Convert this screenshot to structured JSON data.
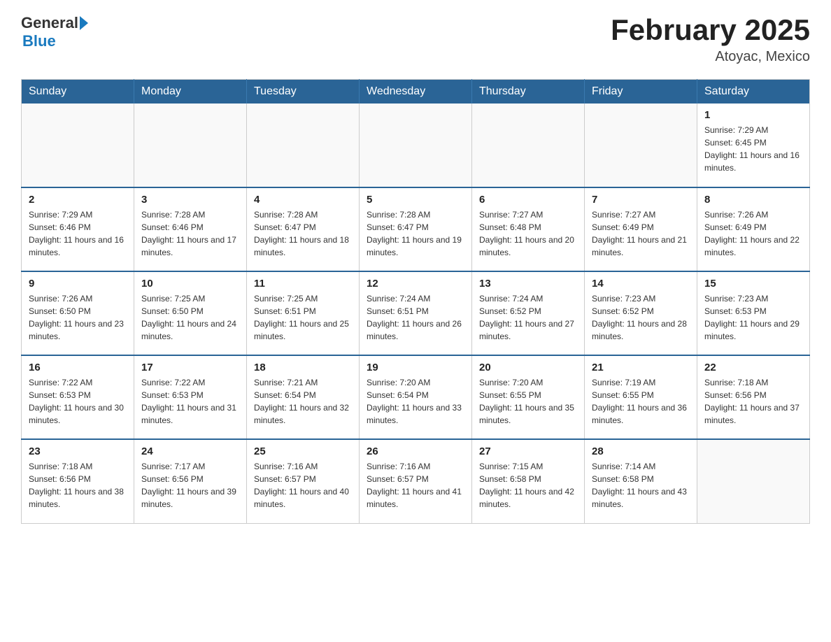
{
  "header": {
    "logo_text_general": "General",
    "logo_text_blue": "Blue",
    "month_title": "February 2025",
    "location": "Atoyac, Mexico"
  },
  "weekdays": [
    "Sunday",
    "Monday",
    "Tuesday",
    "Wednesday",
    "Thursday",
    "Friday",
    "Saturday"
  ],
  "weeks": [
    [
      {
        "day": "",
        "sunrise": "",
        "sunset": "",
        "daylight": ""
      },
      {
        "day": "",
        "sunrise": "",
        "sunset": "",
        "daylight": ""
      },
      {
        "day": "",
        "sunrise": "",
        "sunset": "",
        "daylight": ""
      },
      {
        "day": "",
        "sunrise": "",
        "sunset": "",
        "daylight": ""
      },
      {
        "day": "",
        "sunrise": "",
        "sunset": "",
        "daylight": ""
      },
      {
        "day": "",
        "sunrise": "",
        "sunset": "",
        "daylight": ""
      },
      {
        "day": "1",
        "sunrise": "Sunrise: 7:29 AM",
        "sunset": "Sunset: 6:45 PM",
        "daylight": "Daylight: 11 hours and 16 minutes."
      }
    ],
    [
      {
        "day": "2",
        "sunrise": "Sunrise: 7:29 AM",
        "sunset": "Sunset: 6:46 PM",
        "daylight": "Daylight: 11 hours and 16 minutes."
      },
      {
        "day": "3",
        "sunrise": "Sunrise: 7:28 AM",
        "sunset": "Sunset: 6:46 PM",
        "daylight": "Daylight: 11 hours and 17 minutes."
      },
      {
        "day": "4",
        "sunrise": "Sunrise: 7:28 AM",
        "sunset": "Sunset: 6:47 PM",
        "daylight": "Daylight: 11 hours and 18 minutes."
      },
      {
        "day": "5",
        "sunrise": "Sunrise: 7:28 AM",
        "sunset": "Sunset: 6:47 PM",
        "daylight": "Daylight: 11 hours and 19 minutes."
      },
      {
        "day": "6",
        "sunrise": "Sunrise: 7:27 AM",
        "sunset": "Sunset: 6:48 PM",
        "daylight": "Daylight: 11 hours and 20 minutes."
      },
      {
        "day": "7",
        "sunrise": "Sunrise: 7:27 AM",
        "sunset": "Sunset: 6:49 PM",
        "daylight": "Daylight: 11 hours and 21 minutes."
      },
      {
        "day": "8",
        "sunrise": "Sunrise: 7:26 AM",
        "sunset": "Sunset: 6:49 PM",
        "daylight": "Daylight: 11 hours and 22 minutes."
      }
    ],
    [
      {
        "day": "9",
        "sunrise": "Sunrise: 7:26 AM",
        "sunset": "Sunset: 6:50 PM",
        "daylight": "Daylight: 11 hours and 23 minutes."
      },
      {
        "day": "10",
        "sunrise": "Sunrise: 7:25 AM",
        "sunset": "Sunset: 6:50 PM",
        "daylight": "Daylight: 11 hours and 24 minutes."
      },
      {
        "day": "11",
        "sunrise": "Sunrise: 7:25 AM",
        "sunset": "Sunset: 6:51 PM",
        "daylight": "Daylight: 11 hours and 25 minutes."
      },
      {
        "day": "12",
        "sunrise": "Sunrise: 7:24 AM",
        "sunset": "Sunset: 6:51 PM",
        "daylight": "Daylight: 11 hours and 26 minutes."
      },
      {
        "day": "13",
        "sunrise": "Sunrise: 7:24 AM",
        "sunset": "Sunset: 6:52 PM",
        "daylight": "Daylight: 11 hours and 27 minutes."
      },
      {
        "day": "14",
        "sunrise": "Sunrise: 7:23 AM",
        "sunset": "Sunset: 6:52 PM",
        "daylight": "Daylight: 11 hours and 28 minutes."
      },
      {
        "day": "15",
        "sunrise": "Sunrise: 7:23 AM",
        "sunset": "Sunset: 6:53 PM",
        "daylight": "Daylight: 11 hours and 29 minutes."
      }
    ],
    [
      {
        "day": "16",
        "sunrise": "Sunrise: 7:22 AM",
        "sunset": "Sunset: 6:53 PM",
        "daylight": "Daylight: 11 hours and 30 minutes."
      },
      {
        "day": "17",
        "sunrise": "Sunrise: 7:22 AM",
        "sunset": "Sunset: 6:53 PM",
        "daylight": "Daylight: 11 hours and 31 minutes."
      },
      {
        "day": "18",
        "sunrise": "Sunrise: 7:21 AM",
        "sunset": "Sunset: 6:54 PM",
        "daylight": "Daylight: 11 hours and 32 minutes."
      },
      {
        "day": "19",
        "sunrise": "Sunrise: 7:20 AM",
        "sunset": "Sunset: 6:54 PM",
        "daylight": "Daylight: 11 hours and 33 minutes."
      },
      {
        "day": "20",
        "sunrise": "Sunrise: 7:20 AM",
        "sunset": "Sunset: 6:55 PM",
        "daylight": "Daylight: 11 hours and 35 minutes."
      },
      {
        "day": "21",
        "sunrise": "Sunrise: 7:19 AM",
        "sunset": "Sunset: 6:55 PM",
        "daylight": "Daylight: 11 hours and 36 minutes."
      },
      {
        "day": "22",
        "sunrise": "Sunrise: 7:18 AM",
        "sunset": "Sunset: 6:56 PM",
        "daylight": "Daylight: 11 hours and 37 minutes."
      }
    ],
    [
      {
        "day": "23",
        "sunrise": "Sunrise: 7:18 AM",
        "sunset": "Sunset: 6:56 PM",
        "daylight": "Daylight: 11 hours and 38 minutes."
      },
      {
        "day": "24",
        "sunrise": "Sunrise: 7:17 AM",
        "sunset": "Sunset: 6:56 PM",
        "daylight": "Daylight: 11 hours and 39 minutes."
      },
      {
        "day": "25",
        "sunrise": "Sunrise: 7:16 AM",
        "sunset": "Sunset: 6:57 PM",
        "daylight": "Daylight: 11 hours and 40 minutes."
      },
      {
        "day": "26",
        "sunrise": "Sunrise: 7:16 AM",
        "sunset": "Sunset: 6:57 PM",
        "daylight": "Daylight: 11 hours and 41 minutes."
      },
      {
        "day": "27",
        "sunrise": "Sunrise: 7:15 AM",
        "sunset": "Sunset: 6:58 PM",
        "daylight": "Daylight: 11 hours and 42 minutes."
      },
      {
        "day": "28",
        "sunrise": "Sunrise: 7:14 AM",
        "sunset": "Sunset: 6:58 PM",
        "daylight": "Daylight: 11 hours and 43 minutes."
      },
      {
        "day": "",
        "sunrise": "",
        "sunset": "",
        "daylight": ""
      }
    ]
  ]
}
